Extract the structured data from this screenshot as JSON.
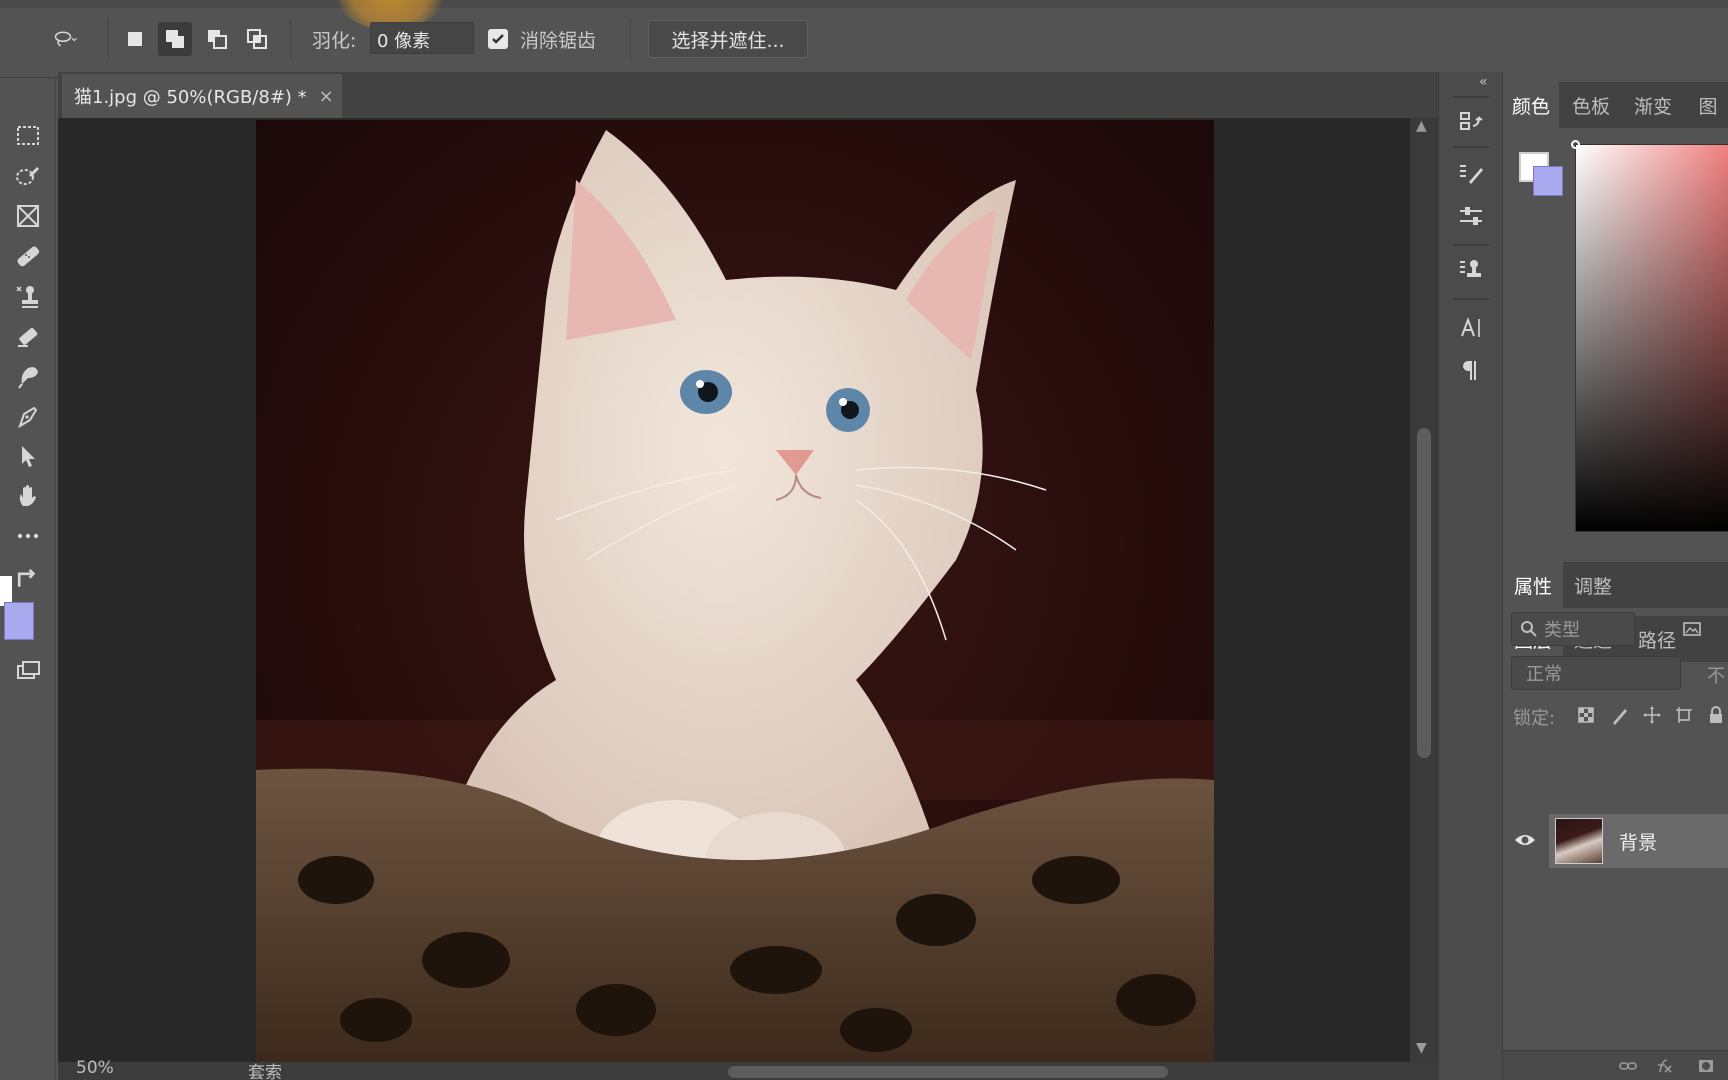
{
  "options_bar": {
    "feather_label": "羽化:",
    "feather_value": "0 像素",
    "antialias_label": "消除锯齿",
    "antialias_checked": true,
    "select_mask_label": "选择并遮住..."
  },
  "document": {
    "tab_title": "猫1.jpg @ 50%(RGB/8#) *",
    "tab_close": "×"
  },
  "status_bar": {
    "zoom": "50%",
    "info": "套索"
  },
  "panels": {
    "color_group_tabs": [
      "颜色",
      "色板",
      "渐变",
      "图"
    ],
    "properties_tabs": [
      "属性",
      "调整"
    ],
    "layers_tabs": [
      "图层",
      "通道",
      "路径"
    ],
    "layer_filter_placeholder": "类型",
    "blend_mode": "正常",
    "opacity_partial": "不",
    "lock_label": "锁定:",
    "layers": [
      {
        "name": "背景",
        "visible": true
      }
    ]
  },
  "colors": {
    "foreground": "#ffffff",
    "background": "#a9a9f0",
    "ui_base": "#535353",
    "canvas_bg": "#282828"
  }
}
